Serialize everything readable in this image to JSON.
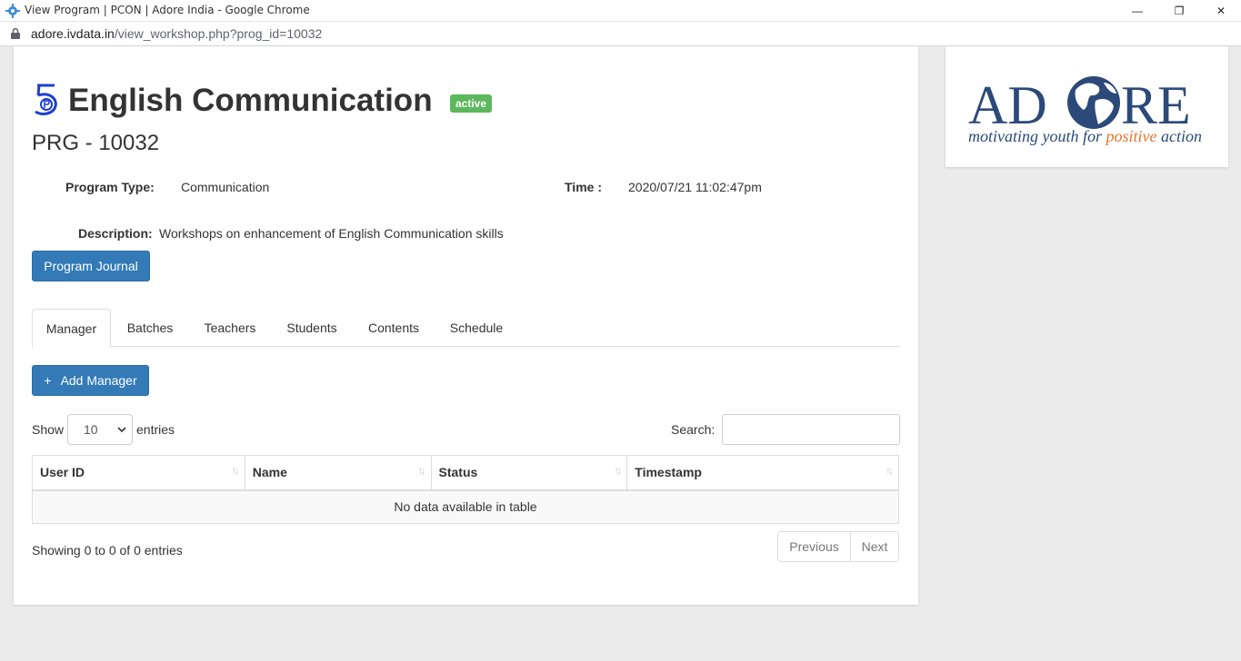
{
  "window": {
    "title": "View Program | PCON | Adore India - Google Chrome",
    "controls": {
      "minimize": "—",
      "restore": "❐",
      "close": "✕"
    }
  },
  "address": {
    "host": "adore.ivdata.in",
    "path": "/view_workshop.php?prog_id=10032"
  },
  "program": {
    "icon": "number-5-icon",
    "title": "English Communication",
    "status": "active",
    "code": "PRG - 10032",
    "type_label": "Program Type:",
    "type_value": "Communication",
    "time_label": "Time :",
    "time_value": "2020/07/21 11:02:47pm",
    "desc_label": "Description:",
    "desc_value": "Workshops on enhancement of English Communication skills",
    "journal_button": "Program Journal"
  },
  "tabs": [
    {
      "label": "Manager",
      "active": true
    },
    {
      "label": "Batches"
    },
    {
      "label": "Teachers"
    },
    {
      "label": "Students"
    },
    {
      "label": "Contents"
    },
    {
      "label": "Schedule"
    }
  ],
  "manager": {
    "add_icon": "+",
    "add_button": "Add Manager",
    "show_label": "Show",
    "entries_value": "10",
    "entries_label": "entries",
    "search_label": "Search:",
    "columns": [
      "User ID",
      "Name",
      "Status",
      "Timestamp"
    ],
    "sort_glyph": "↑↓",
    "empty_text": "No data available in table",
    "info_text": "Showing 0 to 0 of 0 entries",
    "prev_label": "Previous",
    "next_label": "Next"
  },
  "logo": {
    "text_left": "AD",
    "text_right": "RE",
    "tagline_a": "motivating youth for ",
    "tagline_b": "positive",
    "tagline_c": " action",
    "color_primary": "#2b4a7a",
    "color_accent": "#e8742a"
  }
}
